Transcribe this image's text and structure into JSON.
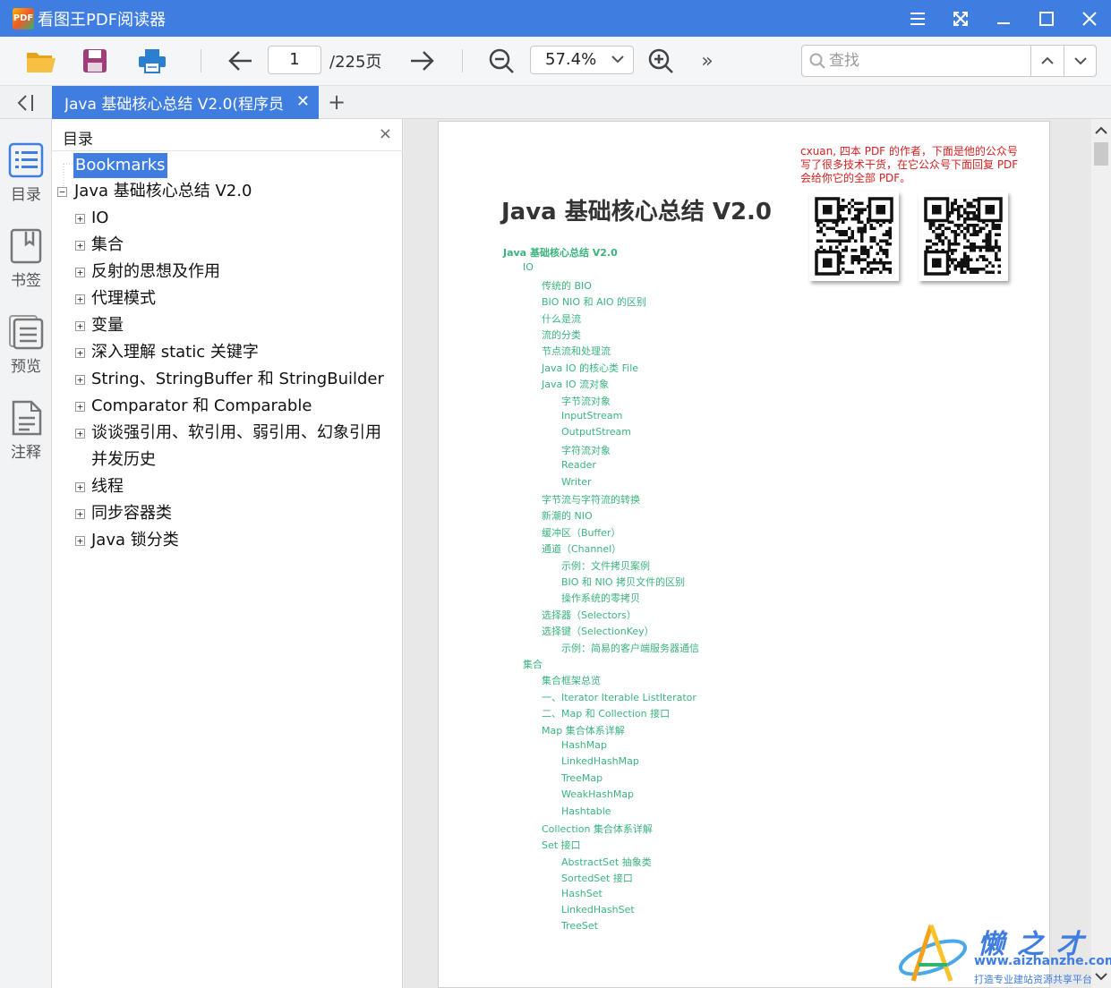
{
  "window": {
    "app_icon_text": "PDF",
    "title": "看图王PDF阅读器",
    "controls": [
      "menu",
      "fullscreen",
      "minimize",
      "maximize",
      "close"
    ]
  },
  "toolbar": {
    "current_page": "1",
    "total_pages": "/225页",
    "zoom": "57.4%",
    "search_placeholder": "查找",
    "more": "»"
  },
  "tabs": {
    "active_label": "Java 基础核心总结 V2.0(程序员",
    "close": "✕",
    "new_tab": "+"
  },
  "rail": [
    {
      "label": "目录",
      "icon": "list-icon"
    },
    {
      "label": "书签",
      "icon": "bookmark-icon"
    },
    {
      "label": "预览",
      "icon": "thumbnails-icon"
    },
    {
      "label": "注释",
      "icon": "annotation-icon"
    }
  ],
  "outline": {
    "title": "目录",
    "close": "×",
    "root": "Bookmarks",
    "book": "Java 基础核心总结 V2.0",
    "items": [
      {
        "label": "IO",
        "expandable": true
      },
      {
        "label": "集合",
        "expandable": true
      },
      {
        "label": "反射的思想及作用",
        "expandable": true
      },
      {
        "label": "代理模式",
        "expandable": true
      },
      {
        "label": "变量",
        "expandable": true
      },
      {
        "label": "深入理解 static 关键字",
        "expandable": true
      },
      {
        "label": "String、StringBuffer 和 StringBuilder",
        "expandable": true
      },
      {
        "label": "Comparator 和 Comparable",
        "expandable": true
      },
      {
        "label": "谈谈强引用、软引用、弱引用、幻象引用",
        "expandable": true
      },
      {
        "label": "并发历史",
        "expandable": false
      },
      {
        "label": "线程",
        "expandable": true
      },
      {
        "label": "同步容器类",
        "expandable": true
      },
      {
        "label": "Java 锁分类",
        "expandable": true
      }
    ]
  },
  "document": {
    "heading": "Java 基础核心总结 V2.0",
    "promo": "cxuan, 四本 PDF 的作者，下面是他的公众号写了很多技术干货，在它公众号下面回复 PDF 会给你它的全部 PDF。",
    "toc": [
      {
        "text": "Java 基础核心总结 V2.0",
        "level": 0
      },
      {
        "text": "IO",
        "level": 1
      },
      {
        "text": "传统的 BIO",
        "level": 2
      },
      {
        "text": "BIO NIO 和 AIO 的区别",
        "level": 2
      },
      {
        "text": "什么是流",
        "level": 2
      },
      {
        "text": "流的分类",
        "level": 2
      },
      {
        "text": "节点流和处理流",
        "level": 2
      },
      {
        "text": "Java IO 的核心类 File",
        "level": 2
      },
      {
        "text": "Java IO 流对象",
        "level": 2
      },
      {
        "text": "字节流对象",
        "level": 3
      },
      {
        "text": "InputStream",
        "level": 3
      },
      {
        "text": "OutputStream",
        "level": 3
      },
      {
        "text": "字符流对象",
        "level": 3
      },
      {
        "text": "Reader",
        "level": 3
      },
      {
        "text": "Writer",
        "level": 3
      },
      {
        "text": "字节流与字符流的转换",
        "level": 2
      },
      {
        "text": "新潮的 NIO",
        "level": 2
      },
      {
        "text": "缓冲区（Buffer）",
        "level": 2
      },
      {
        "text": "通道（Channel）",
        "level": 2
      },
      {
        "text": "示例：文件拷贝案例",
        "level": 3
      },
      {
        "text": "BIO 和 NIO 拷贝文件的区别",
        "level": 3
      },
      {
        "text": "操作系统的零拷贝",
        "level": 3
      },
      {
        "text": "选择器（Selectors）",
        "level": 2
      },
      {
        "text": "选择键（SelectionKey）",
        "level": 2
      },
      {
        "text": "示例：简易的客户端服务器通信",
        "level": 3
      },
      {
        "text": "集合",
        "level": 1
      },
      {
        "text": "集合框架总览",
        "level": 2
      },
      {
        "text": "一、Iterator Iterable ListIterator",
        "level": 2
      },
      {
        "text": "二、Map 和 Collection 接口",
        "level": 2
      },
      {
        "text": "Map 集合体系详解",
        "level": 2
      },
      {
        "text": "HashMap",
        "level": 3
      },
      {
        "text": "LinkedHashMap",
        "level": 3
      },
      {
        "text": "TreeMap",
        "level": 3
      },
      {
        "text": "WeakHashMap",
        "level": 3
      },
      {
        "text": "Hashtable",
        "level": 3
      },
      {
        "text": "Collection 集合体系详解",
        "level": 2
      },
      {
        "text": "Set 接口",
        "level": 2
      },
      {
        "text": "AbstractSet 抽象类",
        "level": 3
      },
      {
        "text": "SortedSet 接口",
        "level": 3
      },
      {
        "text": "HashSet",
        "level": 3
      },
      {
        "text": "LinkedHashSet",
        "level": 3
      },
      {
        "text": "TreeSet",
        "level": 3
      }
    ]
  },
  "watermark": {
    "title": "懒之才",
    "url": "www.aizhanzhe.com",
    "tagline": "打造专业建站资源共享平台"
  },
  "colors": {
    "accent": "#3f7ee0",
    "toc_green": "#3bb37e",
    "promo_red": "#d42020"
  }
}
